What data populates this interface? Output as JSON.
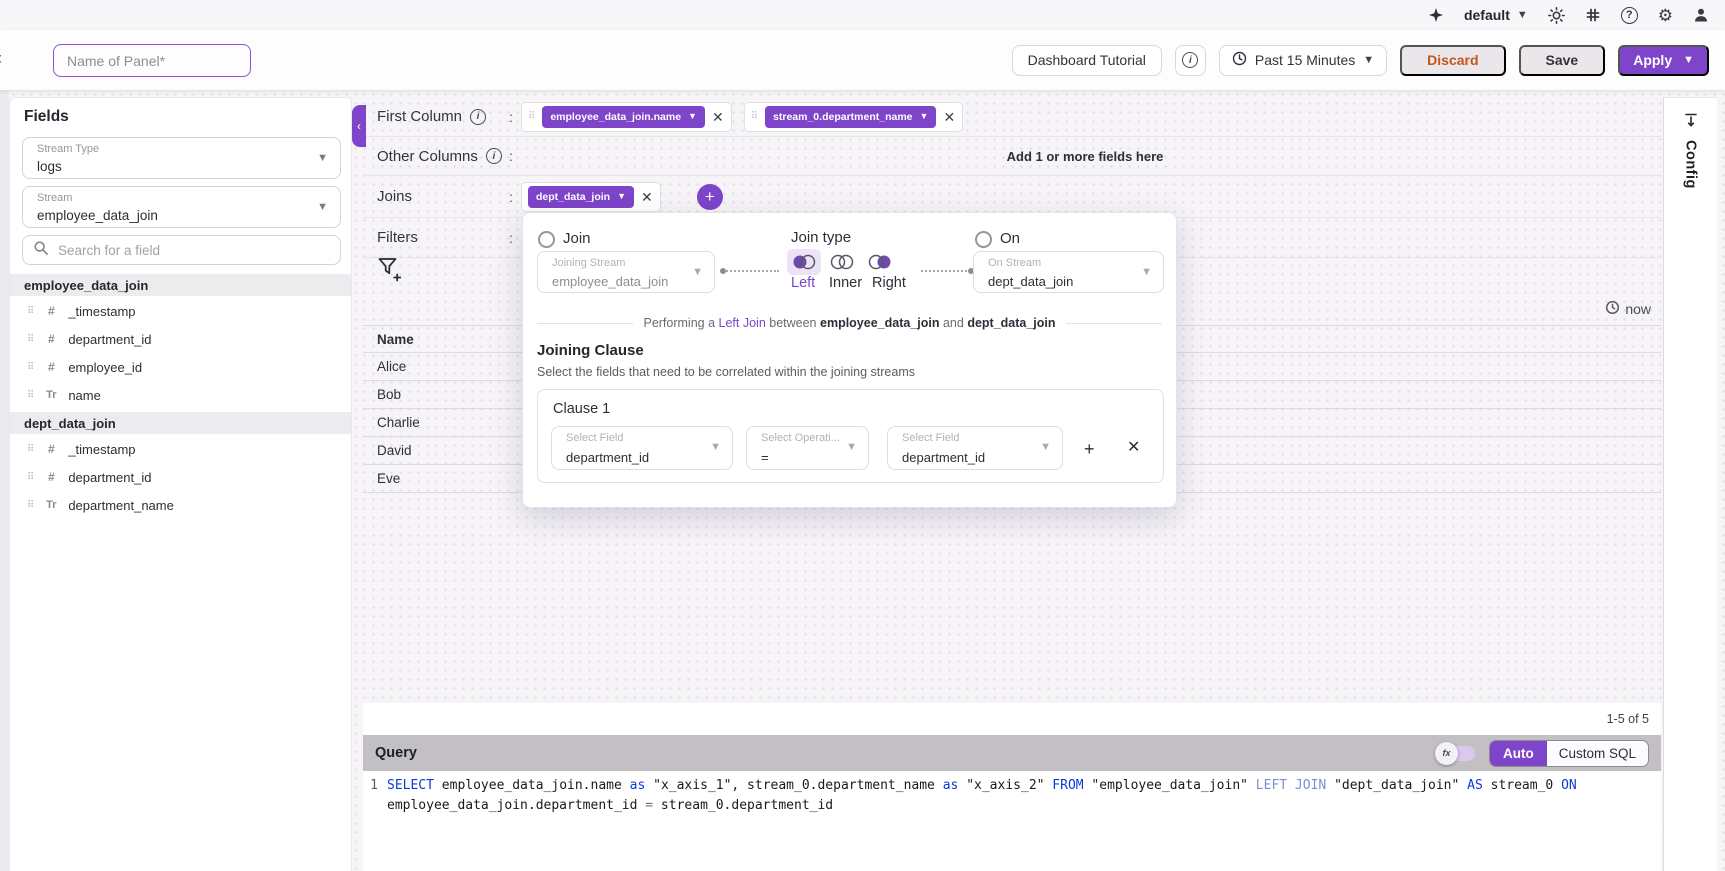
{
  "topbar": {
    "org": "default"
  },
  "toolbar": {
    "panel_name_placeholder": "Name of Panel*",
    "dashboard_button": "Dashboard Tutorial",
    "time_range": "Past 15 Minutes",
    "discard": "Discard",
    "save": "Save",
    "apply": "Apply"
  },
  "sidebar": {
    "title": "Fields",
    "stream_type_label": "Stream Type",
    "stream_type_value": "logs",
    "stream_label": "Stream",
    "stream_value": "employee_data_join",
    "search_placeholder": "Search for a field",
    "groups": [
      {
        "name": "employee_data_join",
        "fields": [
          {
            "icon": "#",
            "name": "_timestamp"
          },
          {
            "icon": "#",
            "name": "department_id"
          },
          {
            "icon": "#",
            "name": "employee_id"
          },
          {
            "icon": "Tr",
            "name": "name"
          }
        ]
      },
      {
        "name": "dept_data_join",
        "fields": [
          {
            "icon": "#",
            "name": "_timestamp"
          },
          {
            "icon": "#",
            "name": "department_id"
          },
          {
            "icon": "Tr",
            "name": "department_name"
          }
        ]
      }
    ]
  },
  "builder": {
    "colon": ":",
    "first_column_label": "First Column",
    "chips": [
      "employee_data_join.name",
      "stream_0.department_name"
    ],
    "other_columns_label": "Other Columns",
    "other_columns_hint": "Add 1 or more fields here",
    "joins_label": "Joins",
    "join_chip": "dept_data_join",
    "filters_label": "Filters",
    "now": "now"
  },
  "results_table": {
    "header": "Name",
    "rows": [
      "Alice",
      "Bob",
      "Charlie",
      "David",
      "Eve"
    ],
    "pagination": "1-5 of 5"
  },
  "join_popup": {
    "join_radio": "Join",
    "joining_stream_label": "Joining Stream",
    "joining_stream_value": "employee_data_join",
    "join_type_label": "Join type",
    "left": "Left",
    "inner": "Inner",
    "right": "Right",
    "on_radio": "On",
    "on_stream_label": "On Stream",
    "on_stream_value": "dept_data_join",
    "summary_prefix": "Performing a ",
    "summary_join": "Left Join",
    "summary_between": " between ",
    "summary_stream1": "employee_data_join",
    "summary_and": " and ",
    "summary_stream2": "dept_data_join",
    "clause_title": "Joining Clause",
    "clause_subtitle": "Select the fields that need to be correlated within the joining streams",
    "clause_name": "Clause 1",
    "field1_label": "Select Field",
    "field1_value": "department_id",
    "op_label": "Select Operati...",
    "op_value": "=",
    "field2_label": "Select Field",
    "field2_value": "department_id"
  },
  "query": {
    "title": "Query",
    "fx": "fx",
    "auto": "Auto",
    "custom_sql": "Custom SQL",
    "line_no": "1",
    "sql1": [
      {
        "t": "SELECT"
      },
      {
        "t": " employee_data_join.name "
      },
      {
        "t": "as"
      },
      {
        "t": " \"x_axis_1\", stream_0.department_name "
      },
      {
        "t": "as"
      },
      {
        "t": " \"x_axis_2\" "
      },
      {
        "t": "FROM"
      },
      {
        "t": " \"employee_data_join\" "
      },
      {
        "t": "LEFT JOIN"
      },
      {
        "t": " \"dept_data_join\" "
      },
      {
        "t": "AS"
      },
      {
        "t": " stream_0 "
      },
      {
        "t": "ON"
      }
    ],
    "sql2": [
      {
        "t": "employee_data_join.department_id "
      },
      {
        "t": "="
      },
      {
        "t": " stream_0.department_id"
      }
    ]
  },
  "config_rail": {
    "label": "Config"
  },
  "colors": {
    "primary": "#7E44C9",
    "selected_chip_bg": "#ECE3F8",
    "discard_text": "#C2571B",
    "query_bar": "#C3C0C3",
    "sql_keyword": "#0B3AD7",
    "sql_keyword_muted": "#7D92CC"
  }
}
